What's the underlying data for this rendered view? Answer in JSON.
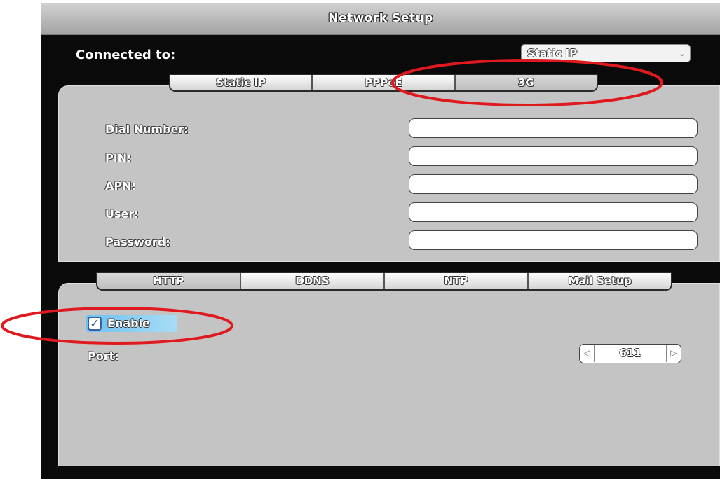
{
  "window": {
    "title": "Network Setup"
  },
  "connection": {
    "label": "Connected to:",
    "selected": "Static IP"
  },
  "tabs_top": [
    {
      "label": "Static IP"
    },
    {
      "label": "PPPoE"
    },
    {
      "label": "3G"
    }
  ],
  "fields": [
    {
      "label": "Dial Number:",
      "value": ""
    },
    {
      "label": "PIN:",
      "value": ""
    },
    {
      "label": "APN:",
      "value": ""
    },
    {
      "label": "User:",
      "value": ""
    },
    {
      "label": "Password:",
      "value": ""
    }
  ],
  "tabs_bottom": [
    {
      "label": "HTTP"
    },
    {
      "label": "DDNS"
    },
    {
      "label": "NTP"
    },
    {
      "label": "Mail Setup"
    }
  ],
  "http": {
    "enable_label": "Enable",
    "enabled": true,
    "port_label": "Port:",
    "port_value": "611"
  },
  "colors": {
    "annotation": "#e0191e",
    "panel": "#c4c4c4",
    "background": "#0a0a0a"
  },
  "icons": {
    "dropdown": "chevron-down-icon",
    "checkbox": "checkmark-icon",
    "prev": "chevron-left-icon",
    "next": "chevron-right-icon"
  }
}
